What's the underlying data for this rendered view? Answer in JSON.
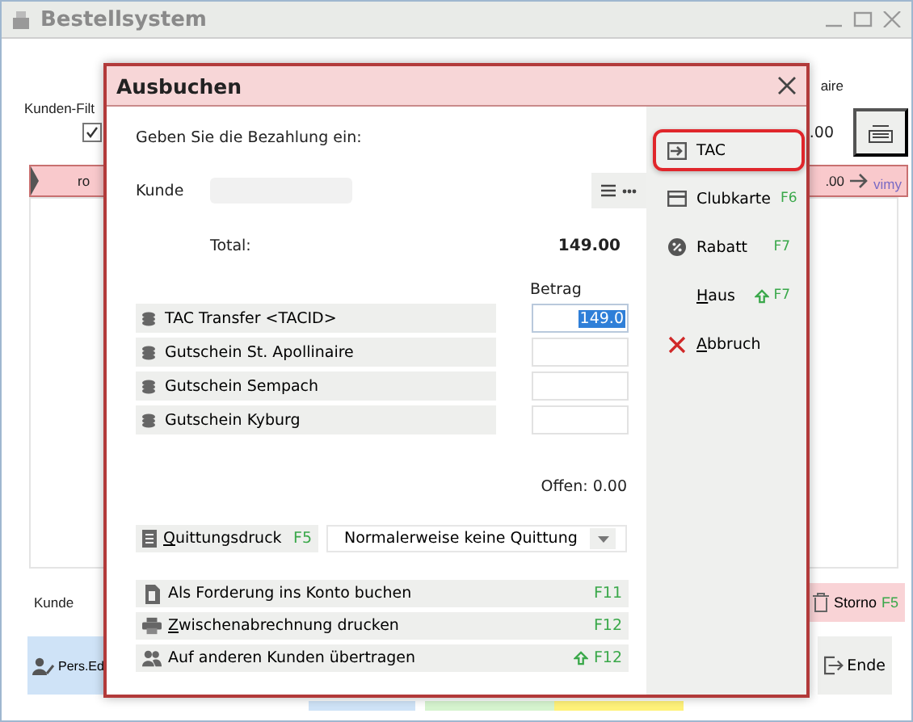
{
  "window": {
    "title": "Bestellsystem"
  },
  "background": {
    "top_right_text": "aire",
    "filter_label": "Kunden-Filt",
    "filter_checked": true,
    "total_right": ".00",
    "order_row": {
      "left": "ro",
      "amount": ".00",
      "user": "vimy"
    },
    "customer_label": "Kunde",
    "storno": {
      "label": "Storno",
      "key": "F5"
    },
    "pers_button": "Pers.Ed",
    "end_button": "Ende"
  },
  "dialog": {
    "title": "Ausbuchen",
    "prompt": "Geben Sie die Bezahlung ein:",
    "customer_label": "Kunde",
    "total_label": "Total:",
    "total_value": "149.00",
    "amount_header": "Betrag",
    "payments": [
      {
        "label": "TAC Transfer <TACID>",
        "value": "149.0",
        "selected": true
      },
      {
        "label": "Gutschein St. Apollinaire",
        "selected": false
      },
      {
        "label": "Gutschein Sempach",
        "selected": false
      },
      {
        "label": "Gutschein Kyburg",
        "selected": false
      }
    ],
    "open_text": "Offen: 0.00",
    "receipt": {
      "label": "Quittungsdruck",
      "mnemonic": true,
      "key": "F5",
      "option": "Normalerweise keine Quittung"
    },
    "actions": [
      {
        "kind": "account",
        "label": "Als Forderung ins Konto buchen",
        "mnemonic": false,
        "shift": false,
        "key": "F11"
      },
      {
        "kind": "print",
        "label": "Zwischenabrechnung drucken",
        "mnemonic": true,
        "shift": false,
        "key": "F12"
      },
      {
        "kind": "transfer",
        "label": "Auf anderen Kunden übertragen",
        "mnemonic": false,
        "shift": true,
        "key": "F12"
      }
    ],
    "side_buttons": [
      {
        "kind": "tac",
        "label": "TAC",
        "mnemonic": false,
        "selected": true
      },
      {
        "kind": "card",
        "label": "Clubkarte",
        "mnemonic": false,
        "shift": false,
        "key": "F6",
        "selected": false
      },
      {
        "kind": "discount",
        "label": "Rabatt",
        "mnemonic": false,
        "shift": false,
        "key": "F7",
        "selected": false
      },
      {
        "kind": "none",
        "label": "Haus",
        "mnemonic": true,
        "shift": true,
        "key": "F7",
        "selected": false
      },
      {
        "kind": "cancel",
        "label": "Abbruch",
        "mnemonic": true,
        "selected": false
      }
    ]
  }
}
